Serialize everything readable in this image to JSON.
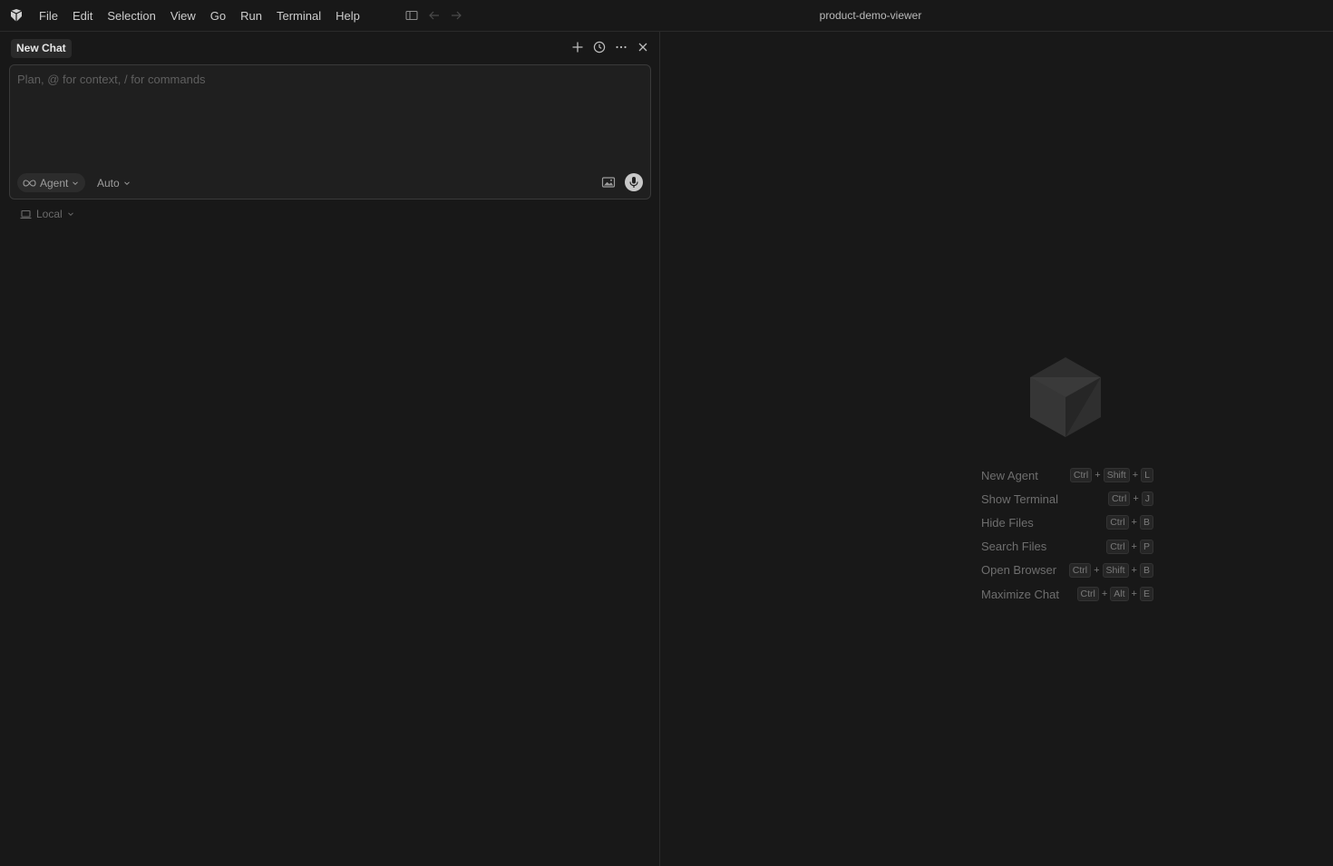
{
  "menu": [
    "File",
    "Edit",
    "Selection",
    "View",
    "Go",
    "Run",
    "Terminal",
    "Help"
  ],
  "window_title": "product-demo-viewer",
  "chat": {
    "tab_label": "New Chat",
    "composer_placeholder": "Plan, @ for context, / for commands",
    "mode_label": "Agent",
    "model_label": "Auto",
    "environment_label": "Local"
  },
  "shortcuts": [
    {
      "label": "New Agent",
      "keys": [
        "Ctrl",
        "Shift",
        "L"
      ]
    },
    {
      "label": "Show Terminal",
      "keys": [
        "Ctrl",
        "J"
      ]
    },
    {
      "label": "Hide Files",
      "keys": [
        "Ctrl",
        "B"
      ]
    },
    {
      "label": "Search Files",
      "keys": [
        "Ctrl",
        "P"
      ]
    },
    {
      "label": "Open Browser",
      "keys": [
        "Ctrl",
        "Shift",
        "B"
      ]
    },
    {
      "label": "Maximize Chat",
      "keys": [
        "Ctrl",
        "Alt",
        "E"
      ]
    }
  ],
  "icons": {
    "app": "cursor-logo-icon",
    "sidebar_toggle": "sidebar-toggle-icon",
    "back": "arrow-left-icon",
    "forward": "arrow-right-icon",
    "new_chat": "plus-icon",
    "history": "clock-icon",
    "more": "ellipsis-icon",
    "close": "close-icon",
    "mode": "infinity-icon",
    "image": "image-icon",
    "mic": "microphone-icon",
    "environment": "laptop-icon",
    "watermark": "cursor-cube-logo"
  }
}
